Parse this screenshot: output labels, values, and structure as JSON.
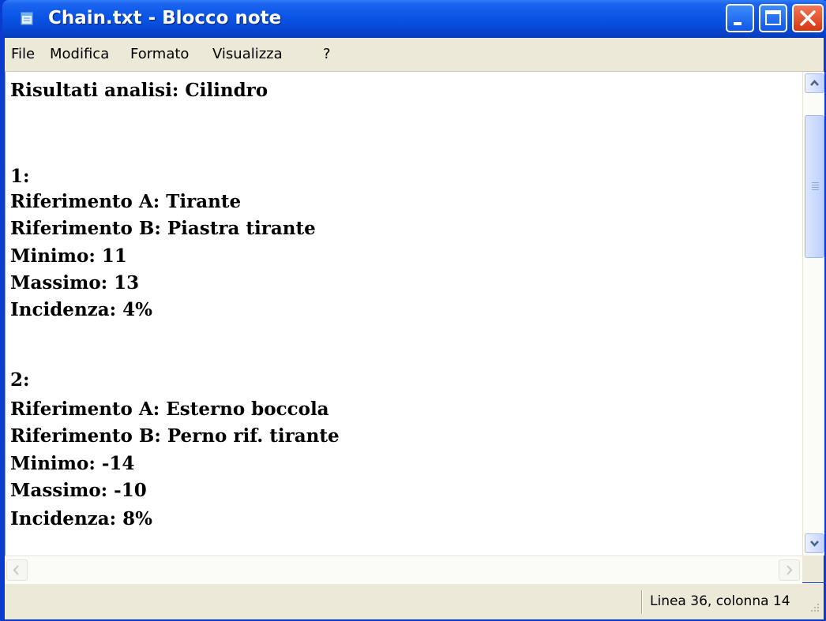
{
  "window": {
    "title": "Chain.txt - Blocco note"
  },
  "menu": {
    "file": "File",
    "modifica": "Modifica",
    "formato": "Formato",
    "visualizza": "Visualizza",
    "help": "?"
  },
  "editor": {
    "lines": [
      "Risultati analisi: Cilindro",
      "",
      "1:",
      "Riferimento A: Tirante",
      "Riferimento B: Piastra tirante",
      "Minimo: 11",
      "Massimo: 13",
      "Incidenza: 4%",
      "",
      "2:",
      "Riferimento A: Esterno boccola",
      "Riferimento B: Perno rif. tirante",
      "Minimo: -14",
      "Massimo: -10",
      "Incidenza: 8%"
    ]
  },
  "status": {
    "position": "Linea 36, colonna 14"
  },
  "colors": {
    "titlebar": "#0a55e6",
    "chrome": "#ece9d8",
    "close": "#d4380f"
  },
  "icons": {
    "app": "notepad-icon",
    "minimize": "minimize-icon",
    "maximize": "maximize-icon",
    "close": "close-icon"
  }
}
